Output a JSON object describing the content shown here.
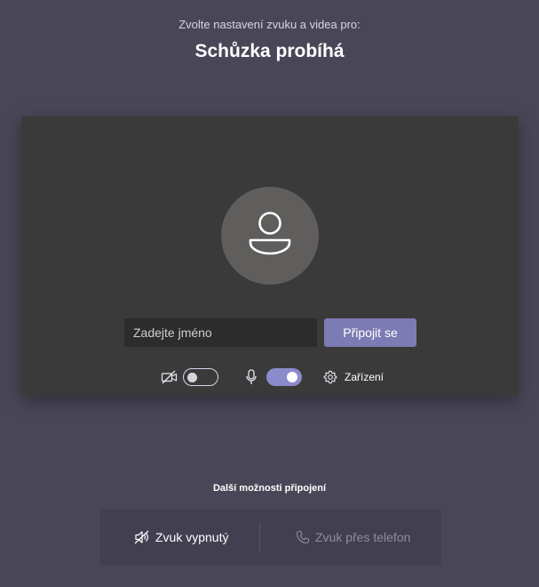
{
  "header": {
    "subtitle": "Zvolte nastavení zvuku a videa pro:",
    "title": "Schůzka probíhá"
  },
  "preview": {
    "avatar_icon": "person-icon",
    "name_input": {
      "value": "",
      "placeholder": "Zadejte jméno"
    },
    "join_label": "Připojit se",
    "controls": {
      "camera_icon": "camera-off-icon",
      "camera_on": false,
      "mic_icon": "microphone-icon",
      "mic_on": true,
      "devices_icon": "gear-icon",
      "devices_label": "Zařízení"
    }
  },
  "more_options": {
    "label": "Další možnosti připojení",
    "items": [
      {
        "label": "Zvuk vypnutý",
        "icon": "speaker-off-icon",
        "enabled": true
      },
      {
        "label": "Zvuk přes telefon",
        "icon": "phone-icon",
        "enabled": false
      }
    ]
  },
  "colors": {
    "background": "#494757",
    "preview_background": "#3b3a3a",
    "accent": "#7d7bb4",
    "toggle_on": "#8b8acb"
  }
}
